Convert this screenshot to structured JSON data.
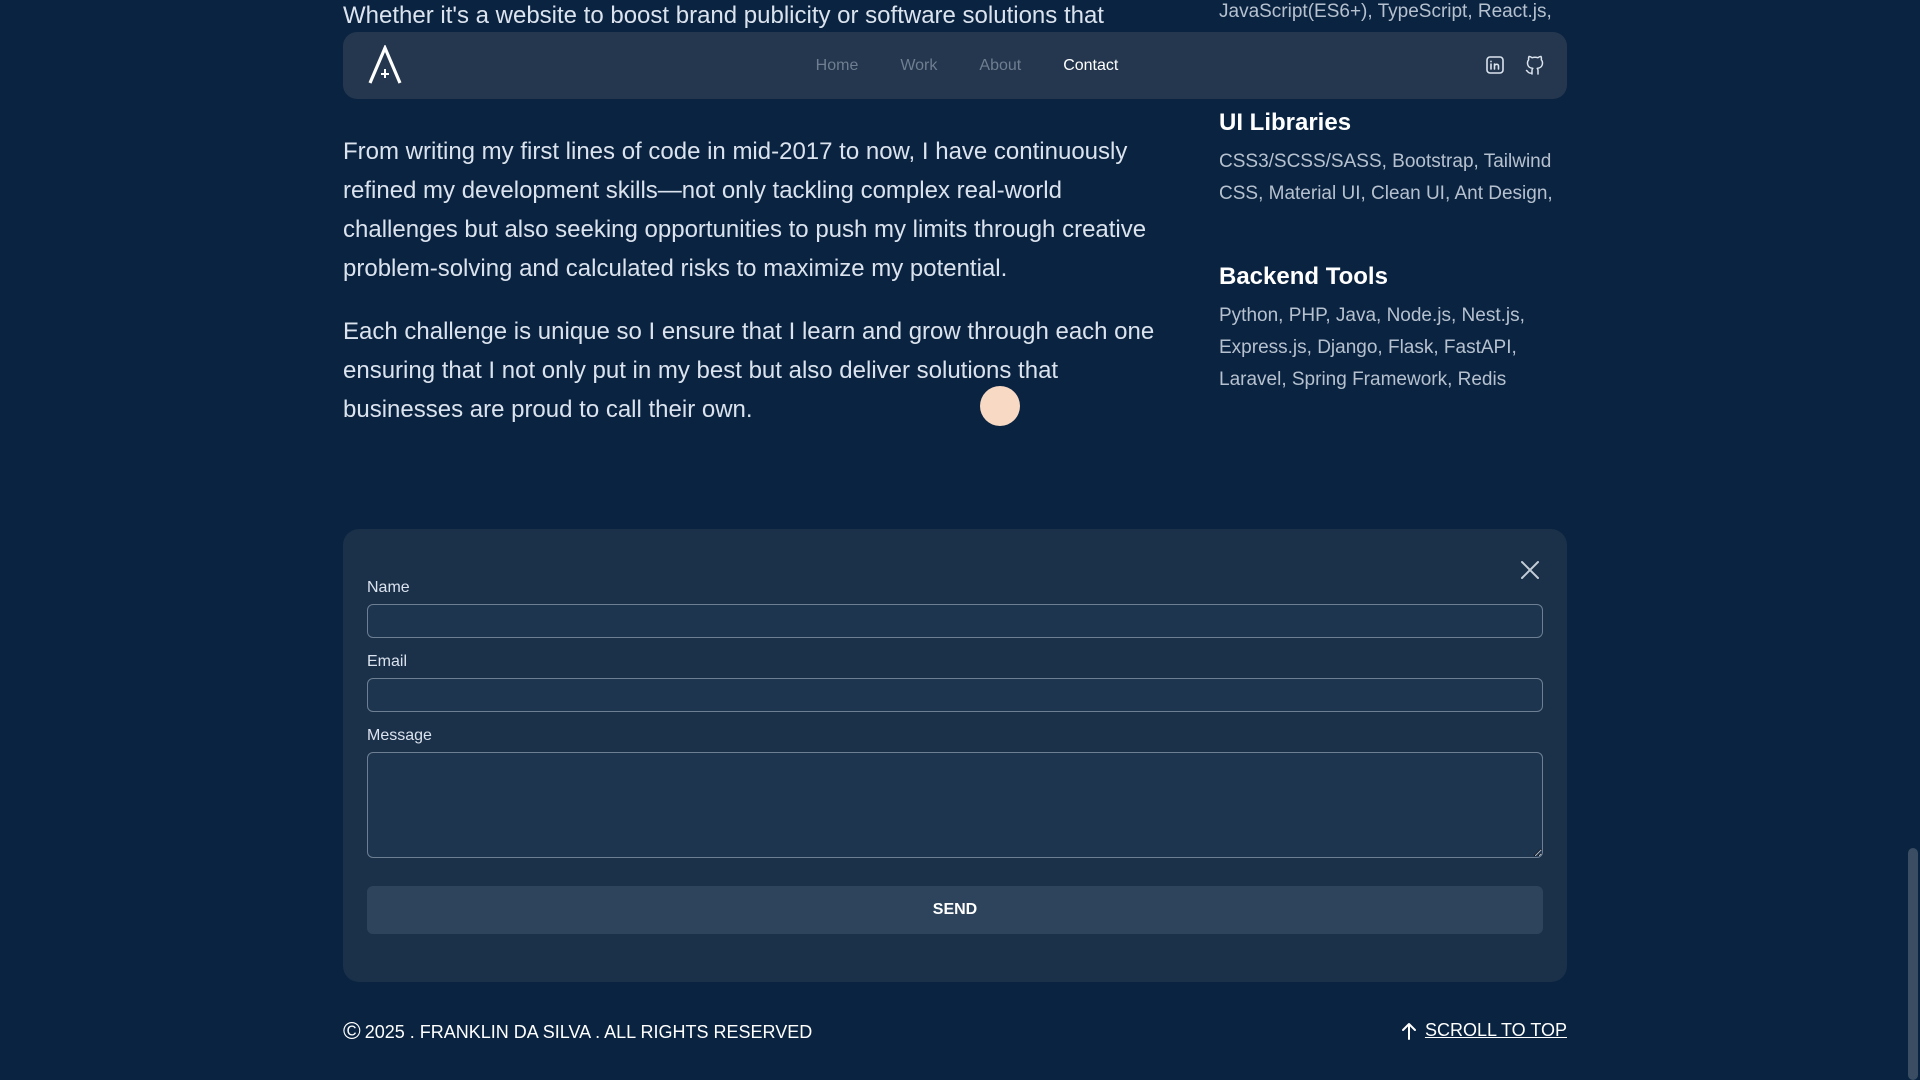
{
  "nav": {
    "logo_alt": "A",
    "links": [
      "Home",
      "Work",
      "About",
      "Contact"
    ],
    "active": "Contact",
    "icons": [
      "linkedin-icon",
      "github-icon"
    ]
  },
  "about": {
    "partial_line": "Whether it's a website to boost brand publicity or software solutions that",
    "paragraph_1": "From writing my first lines of code in mid-2017 to now, I have continuously refined my development skills—not only tackling complex real-world challenges but also seeking opportunities to push my limits through creative problem-solving and calculated risks to maximize my potential.",
    "paragraph_2": "Each challenge is unique so I ensure that I learn and grow through each one ensuring that I not only put in my best but also deliver solutions that businesses are proud to call their own."
  },
  "skills": {
    "partial_line": "JavaScript(ES6+), TypeScript, React.js,",
    "ui_libraries": {
      "title": "UI Libraries",
      "list": "CSS3/SCSS/SASS, Bootstrap, Tailwind CSS, Material UI, Clean UI, Ant Design,"
    },
    "backend_tools": {
      "title": "Backend Tools",
      "list": "Python, PHP, Java, Node.js, Nest.js, Express.js, Django, Flask, FastAPI, Laravel, Spring Framework, Redis"
    }
  },
  "form": {
    "name_label": "Name",
    "name_value": "",
    "email_label": "Email",
    "email_value": "",
    "message_label": "Message",
    "message_value": "",
    "send_label": "SEND"
  },
  "footer": {
    "copyright_symbol": "©",
    "copyright_text": "2025 . FRANKLIN DA SILVA . ALL RIGHTS RESERVED",
    "scroll_label": "SCROLL TO TOP"
  },
  "colors": {
    "background": "#0a2340",
    "card": "#1b3049",
    "navbar": "#283a50",
    "cursor_dot": "#f7d9c4"
  }
}
